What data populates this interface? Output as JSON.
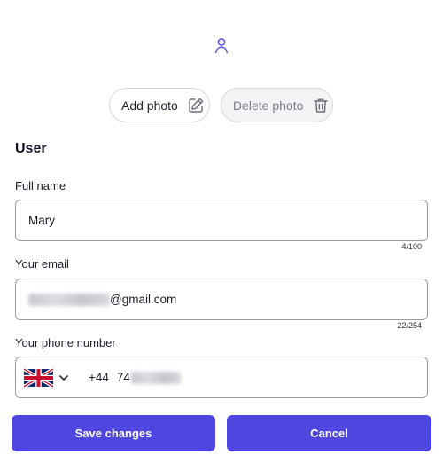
{
  "colors": {
    "accent": "#4f46e0",
    "border": "#9a9aa6",
    "text": "#1b1b2e"
  },
  "avatar": {
    "icon": "user-icon"
  },
  "photo_actions": {
    "add_label": "Add photo",
    "add_icon": "edit-icon",
    "delete_label": "Delete photo",
    "delete_icon": "trash-icon"
  },
  "section": {
    "title": "User"
  },
  "full_name": {
    "label": "Full name",
    "value": "Mary",
    "counter": "4/100"
  },
  "email": {
    "label": "Your email",
    "value_visible": "@gmail.com",
    "counter": "22/254"
  },
  "phone": {
    "label": "Your phone number",
    "country_icon": "uk-flag-icon",
    "dial_code": "+44",
    "number_prefix": "74"
  },
  "actions": {
    "save_label": "Save changes",
    "cancel_label": "Cancel"
  }
}
